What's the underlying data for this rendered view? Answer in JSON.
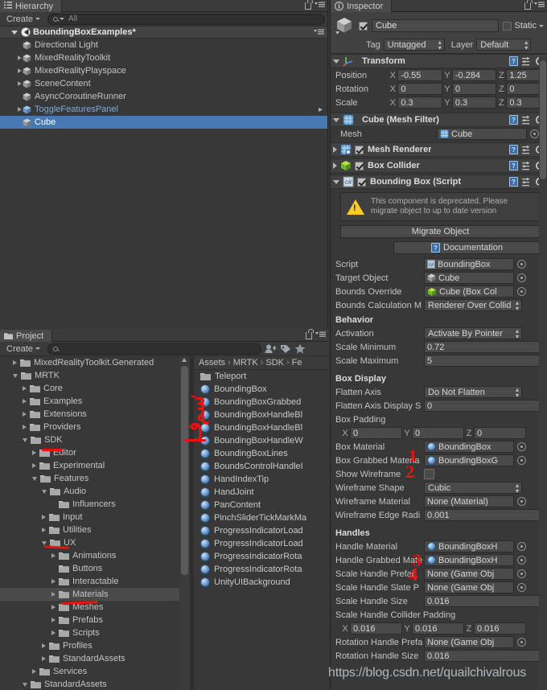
{
  "hierarchy": {
    "tab_label": "Hierarchy",
    "create_label": "Create",
    "search_placeholder": "All",
    "scene_name": "BoundingBoxExamples*",
    "items": [
      {
        "label": "Directional Light",
        "indent": 1,
        "expandable": false,
        "selected": false,
        "prefab": false
      },
      {
        "label": "MixedRealityToolkit",
        "indent": 1,
        "expandable": true,
        "selected": false,
        "prefab": false
      },
      {
        "label": "MixedRealityPlayspace",
        "indent": 1,
        "expandable": true,
        "selected": false,
        "prefab": false
      },
      {
        "label": "SceneContent",
        "indent": 1,
        "expandable": true,
        "selected": false,
        "prefab": false
      },
      {
        "label": "AsyncCoroutineRunner",
        "indent": 1,
        "expandable": false,
        "selected": false,
        "prefab": false
      },
      {
        "label": "ToggleFeaturesPanel",
        "indent": 1,
        "expandable": true,
        "selected": false,
        "prefab": true
      },
      {
        "label": "Cube",
        "indent": 1,
        "expandable": false,
        "selected": true,
        "prefab": false
      }
    ]
  },
  "project": {
    "tab_label": "Project",
    "create_label": "Create",
    "search_placeholder": "",
    "breadcrumb": [
      "Assets",
      "MRTK",
      "SDK",
      "Fe"
    ],
    "tree": [
      {
        "label": "MixedRealityToolkit.Generated",
        "indent": 1,
        "state": "collapsed"
      },
      {
        "label": "MRTK",
        "indent": 1,
        "state": "expanded"
      },
      {
        "label": "Core",
        "indent": 2,
        "state": "collapsed"
      },
      {
        "label": "Examples",
        "indent": 2,
        "state": "collapsed"
      },
      {
        "label": "Extensions",
        "indent": 2,
        "state": "collapsed"
      },
      {
        "label": "Providers",
        "indent": 2,
        "state": "collapsed"
      },
      {
        "label": "SDK",
        "indent": 2,
        "state": "expanded"
      },
      {
        "label": "Editor",
        "indent": 3,
        "state": "collapsed"
      },
      {
        "label": "Experimental",
        "indent": 3,
        "state": "collapsed"
      },
      {
        "label": "Features",
        "indent": 3,
        "state": "expanded"
      },
      {
        "label": "Audio",
        "indent": 4,
        "state": "expanded"
      },
      {
        "label": "Influencers",
        "indent": 5,
        "state": "leaf"
      },
      {
        "label": "Input",
        "indent": 4,
        "state": "collapsed"
      },
      {
        "label": "Utilities",
        "indent": 4,
        "state": "collapsed"
      },
      {
        "label": "UX",
        "indent": 4,
        "state": "expanded"
      },
      {
        "label": "Animations",
        "indent": 5,
        "state": "collapsed"
      },
      {
        "label": "Buttons",
        "indent": 5,
        "state": "leaf"
      },
      {
        "label": "Interactable",
        "indent": 5,
        "state": "collapsed"
      },
      {
        "label": "Materials",
        "indent": 5,
        "state": "collapsed",
        "selected": true
      },
      {
        "label": "Meshes",
        "indent": 5,
        "state": "collapsed"
      },
      {
        "label": "Prefabs",
        "indent": 5,
        "state": "collapsed"
      },
      {
        "label": "Scripts",
        "indent": 5,
        "state": "collapsed"
      },
      {
        "label": "Profiles",
        "indent": 4,
        "state": "collapsed"
      },
      {
        "label": "StandardAssets",
        "indent": 4,
        "state": "collapsed"
      },
      {
        "label": "Services",
        "indent": 3,
        "state": "collapsed"
      },
      {
        "label": "StandardAssets",
        "indent": 2,
        "state": "expanded"
      }
    ],
    "assets": [
      {
        "label": "Teleport",
        "type": "folder"
      },
      {
        "label": "BoundingBox",
        "type": "material"
      },
      {
        "label": "BoundingBoxGrabbed",
        "type": "material"
      },
      {
        "label": "BoundingBoxHandleBl",
        "type": "material"
      },
      {
        "label": "BoundingBoxHandleBl",
        "type": "material"
      },
      {
        "label": "BoundingBoxHandleW",
        "type": "material"
      },
      {
        "label": "BoundingBoxLines",
        "type": "material"
      },
      {
        "label": "BoundsControlHandleI",
        "type": "material"
      },
      {
        "label": "HandIndexTip",
        "type": "material"
      },
      {
        "label": "HandJoint",
        "type": "material"
      },
      {
        "label": "PanContent",
        "type": "material"
      },
      {
        "label": "PinchSliderTickMarkMa",
        "type": "material"
      },
      {
        "label": "ProgressIndicatorLoad",
        "type": "material"
      },
      {
        "label": "ProgressIndicatorLoad",
        "type": "material"
      },
      {
        "label": "ProgressIndicatorRota",
        "type": "material"
      },
      {
        "label": "ProgressIndicatorRota",
        "type": "material"
      },
      {
        "label": "UnityUIBackground",
        "type": "material"
      }
    ]
  },
  "inspector": {
    "tab_label": "Inspector",
    "object_name": "Cube",
    "object_enabled": true,
    "static_label": "Static",
    "static_checked": false,
    "tag_label": "Tag",
    "tag_value": "Untagged",
    "layer_label": "Layer",
    "layer_value": "Default",
    "transform": {
      "title": "Transform",
      "rows": [
        {
          "label": "Position",
          "x": "-0.55",
          "y": "-0.284",
          "z": "1.25"
        },
        {
          "label": "Rotation",
          "x": "0",
          "y": "0",
          "z": "0"
        },
        {
          "label": "Scale",
          "x": "0.3",
          "y": "0.3",
          "z": "0.3"
        }
      ]
    },
    "mesh_filter": {
      "title": "Cube (Mesh Filter)",
      "mesh_label": "Mesh",
      "mesh_value": "Cube"
    },
    "components": [
      {
        "title": "Mesh Renderer",
        "checked": true,
        "expanded": false,
        "icon": "mesh-renderer-icon"
      },
      {
        "title": "Box Collider",
        "checked": true,
        "expanded": false,
        "icon": "box-collider-icon"
      },
      {
        "title": "Bounding Box (Script",
        "checked": true,
        "expanded": true,
        "icon": "script-icon"
      }
    ],
    "warning_text": "This component is deprecated. Please migrate object to up to date version",
    "migrate_button": "Migrate Object",
    "documentation_button": "Documentation",
    "script_rows": [
      {
        "label": "Script",
        "value": "BoundingBox",
        "kind": "object-disabled",
        "icon": "script-asset-icon"
      },
      {
        "label": "Target Object",
        "value": "Cube",
        "kind": "object",
        "icon": "gameobject-icon"
      },
      {
        "label": "Bounds Override",
        "value": "Cube (Box Col",
        "kind": "object",
        "icon": "collider-icon"
      },
      {
        "label": "Bounds Calculation M",
        "value": "Renderer Over Collid",
        "kind": "enum"
      }
    ],
    "behavior": {
      "header": "Behavior",
      "rows": [
        {
          "label": "Activation",
          "value": "Activate By Pointer",
          "kind": "enum"
        },
        {
          "label": "Scale Minimum",
          "value": "0.72",
          "kind": "text"
        },
        {
          "label": "Scale Maximum",
          "value": "5",
          "kind": "text"
        }
      ]
    },
    "box_display": {
      "header": "Box Display",
      "rows": [
        {
          "label": "Flatten Axis",
          "value": "Do Not Flatten",
          "kind": "enum"
        },
        {
          "label": "Flatten Axis Display S",
          "value": "0",
          "kind": "text"
        }
      ],
      "box_padding_label": "Box Padding",
      "box_padding": {
        "x": "0",
        "y": "0",
        "z": "0"
      },
      "rows2": [
        {
          "label": "Box Material",
          "value": "BoundingBox",
          "kind": "object-mat"
        },
        {
          "label": "Box Grabbed Materia",
          "value": "BoundingBoxG",
          "kind": "object-mat"
        },
        {
          "label": "Show Wireframe",
          "value": "",
          "kind": "checkbox",
          "checked": false
        },
        {
          "label": "Wireframe Shape",
          "value": "Cubic",
          "kind": "enum"
        },
        {
          "label": "Wireframe Material",
          "value": "None (Material)",
          "kind": "object"
        },
        {
          "label": "Wireframe Edge Radi",
          "value": "0.001",
          "kind": "text"
        }
      ]
    },
    "handles": {
      "header": "Handles",
      "rows": [
        {
          "label": "Handle Material",
          "value": "BoundingBoxH",
          "kind": "object-mat"
        },
        {
          "label": "Handle Grabbed Mate",
          "value": "BoundingBoxH",
          "kind": "object-mat"
        },
        {
          "label": "Scale Handle Prefab",
          "value": "None (Game Obj",
          "kind": "object"
        },
        {
          "label": "Scale Handle Slate P",
          "value": "None (Game Obj",
          "kind": "object"
        },
        {
          "label": "Scale Handle Size",
          "value": "0.016",
          "kind": "text"
        }
      ],
      "collider_padding_label": "Scale Handle Collider Padding",
      "collider_padding": {
        "x": "0.016",
        "y": "0.016",
        "z": "0.016"
      },
      "rows2": [
        {
          "label": "Rotation Handle Prefa",
          "value": "None (Game Obj",
          "kind": "object"
        },
        {
          "label": "Rotation Handle Size",
          "value": "0.016",
          "kind": "text"
        }
      ]
    }
  },
  "annotations": {
    "marks": [
      "1",
      "2",
      "3",
      "4"
    ],
    "color": "#ee1111"
  },
  "watermark": "https://blog.csdn.net/quailchivalrous"
}
